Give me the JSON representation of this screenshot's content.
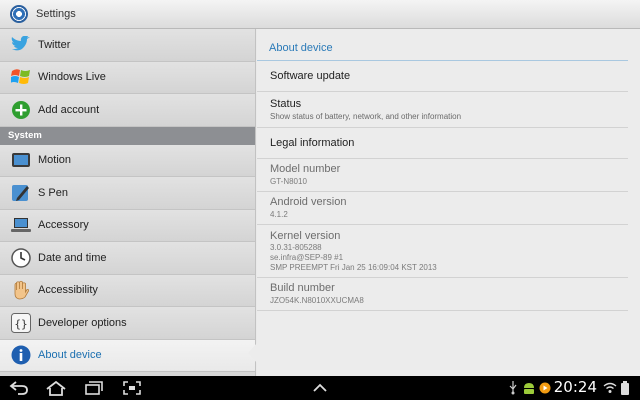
{
  "titlebar": {
    "title": "Settings",
    "icon": "settings-gear-icon"
  },
  "sidebar": {
    "items_top": [
      {
        "label": "Twitter",
        "icon": "twitter-bird-icon"
      },
      {
        "label": "Windows Live",
        "icon": "windows-flag-icon"
      },
      {
        "label": "Add account",
        "icon": "plus-circle-icon"
      }
    ],
    "section_label": "System",
    "items_system": [
      {
        "label": "Motion",
        "icon": "tablet-motion-icon"
      },
      {
        "label": "S Pen",
        "icon": "pen-icon"
      },
      {
        "label": "Accessory",
        "icon": "laptop-icon"
      },
      {
        "label": "Date and time",
        "icon": "clock-icon"
      },
      {
        "label": "Accessibility",
        "icon": "hand-icon"
      },
      {
        "label": "Developer options",
        "icon": "braces-icon"
      },
      {
        "label": "About device",
        "icon": "info-icon",
        "selected": true
      }
    ]
  },
  "detail": {
    "header": "About device",
    "rows": [
      {
        "title": "Software update",
        "sub": ""
      },
      {
        "title": "Status",
        "sub": "Show status of battery, network, and other information"
      },
      {
        "title": "Legal information",
        "sub": ""
      }
    ],
    "info": [
      {
        "title": "Model number",
        "lines": [
          "GT-N8010"
        ]
      },
      {
        "title": "Android version",
        "lines": [
          "4.1.2"
        ]
      },
      {
        "title": "Kernel version",
        "lines": [
          "3.0.31-805288",
          "se.infra@SEP-89 #1",
          "SMP PREEMPT Fri Jan 25 16:09:04 KST 2013"
        ]
      },
      {
        "title": "Build number",
        "lines": [
          "JZO54K.N8010XXUCMA8"
        ]
      }
    ]
  },
  "navbar": {
    "clock": "20:24",
    "buttons": [
      "back-icon",
      "home-icon",
      "recent-apps-icon",
      "screenshot-icon",
      "chevron-up-icon"
    ],
    "status_icons": [
      "usb-icon",
      "android-icon",
      "media-icon",
      "wifi-icon",
      "battery-icon"
    ]
  },
  "colors": {
    "accent": "#2a7ab8",
    "nav_bg": "#000000",
    "section_bg": "#8d8f93"
  }
}
